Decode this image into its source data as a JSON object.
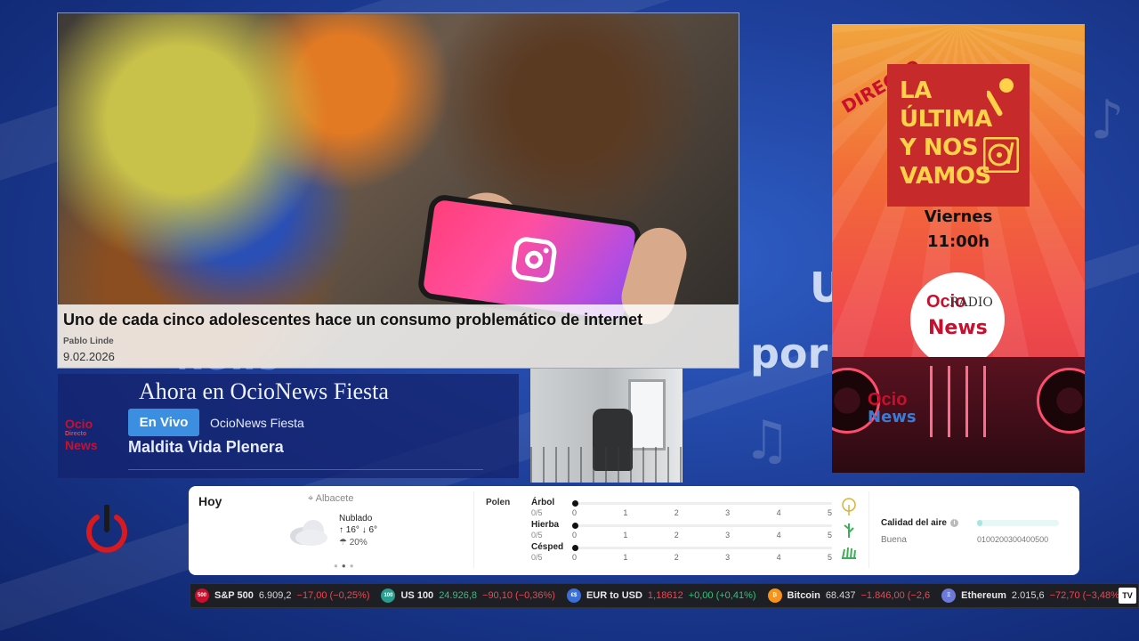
{
  "background": {
    "words": [
      "News",
      "U",
      "por"
    ]
  },
  "article": {
    "headline": "Uno de cada cinco adolescentes hace un consumo problemático de internet",
    "author": "Pablo Linde",
    "date": "9.02.2026"
  },
  "promo": {
    "directo": "DIRECTO",
    "title_lines": [
      "LA",
      "ÚLTIMA",
      "Y NOS",
      "VAMOS"
    ],
    "day": "Viernes",
    "time": "11:00h",
    "logo": {
      "ocio": "Ocio",
      "radio": "RADIO",
      "news": "News"
    },
    "mini_logo": {
      "ocio": "Ocio",
      "news": "News"
    }
  },
  "now_playing": {
    "heading": "Ahora en OcioNews Fiesta",
    "live_label": "En Vivo",
    "station": "OcioNews Fiesta",
    "song": "Maldita Vida Plenera",
    "logo": {
      "ocio": "Ocio",
      "directo": "Directo",
      "news": "News"
    }
  },
  "weather": {
    "today_label": "Hoy",
    "location": "Albacete",
    "condition": "Nublado",
    "high": "↑ 16°",
    "low": "↓ 6°",
    "rain": "20%",
    "carousel": {
      "count": 3,
      "active": 2
    },
    "polen": {
      "label": "Polen",
      "scale": [
        "0",
        "1",
        "2",
        "3",
        "4",
        "5"
      ],
      "rows": [
        {
          "name": "Árbol",
          "value_label": "0/5",
          "level": 0,
          "icon": "tree-icon"
        },
        {
          "name": "Hierba",
          "value_label": "0/5",
          "level": 0,
          "icon": "grass-icon"
        },
        {
          "name": "Césped",
          "value_label": "0/5",
          "level": 0,
          "icon": "lawn-icon"
        }
      ]
    },
    "air": {
      "label": "Calidad del aire",
      "status": "Buena",
      "scale": "0100200300400500",
      "level_fraction": 0.07
    }
  },
  "ticker": {
    "items": [
      {
        "badge": "500",
        "badge_color": "#c8102e",
        "name": "S&P 500",
        "price": "6.909,2",
        "change": "−17,00 (−0,25%)",
        "trend": "neg"
      },
      {
        "badge": "100",
        "badge_color": "#2a9d8f",
        "name": "US 100",
        "price": "24.926,8",
        "change": "−90,10 (−0,36%)",
        "trend": "neg",
        "price_trend": "pos"
      },
      {
        "badge": "€$",
        "badge_color": "#3a6fd8",
        "name": "EUR to USD",
        "price": "1,18612",
        "change": "+0,00 (+0,41%)",
        "trend": "pos",
        "price_trend": "neg"
      },
      {
        "badge": "₿",
        "badge_color": "#f7931a",
        "name": "Bitcoin",
        "price": "68.437",
        "change": "−1.846,00 (−2,6",
        "trend": "neg"
      },
      {
        "badge": "Ξ",
        "badge_color": "#6c7bd8",
        "name": "Ethereum",
        "price": "2.015,6",
        "change": "−72,70 (−3,48%)",
        "trend": "neg"
      }
    ],
    "widget_mark": "TV"
  },
  "colors": {
    "brand_red": "#c8102e",
    "live_blue": "#3c8fe0",
    "ticker_neg": "#f0454f",
    "ticker_pos": "#30c37a"
  }
}
